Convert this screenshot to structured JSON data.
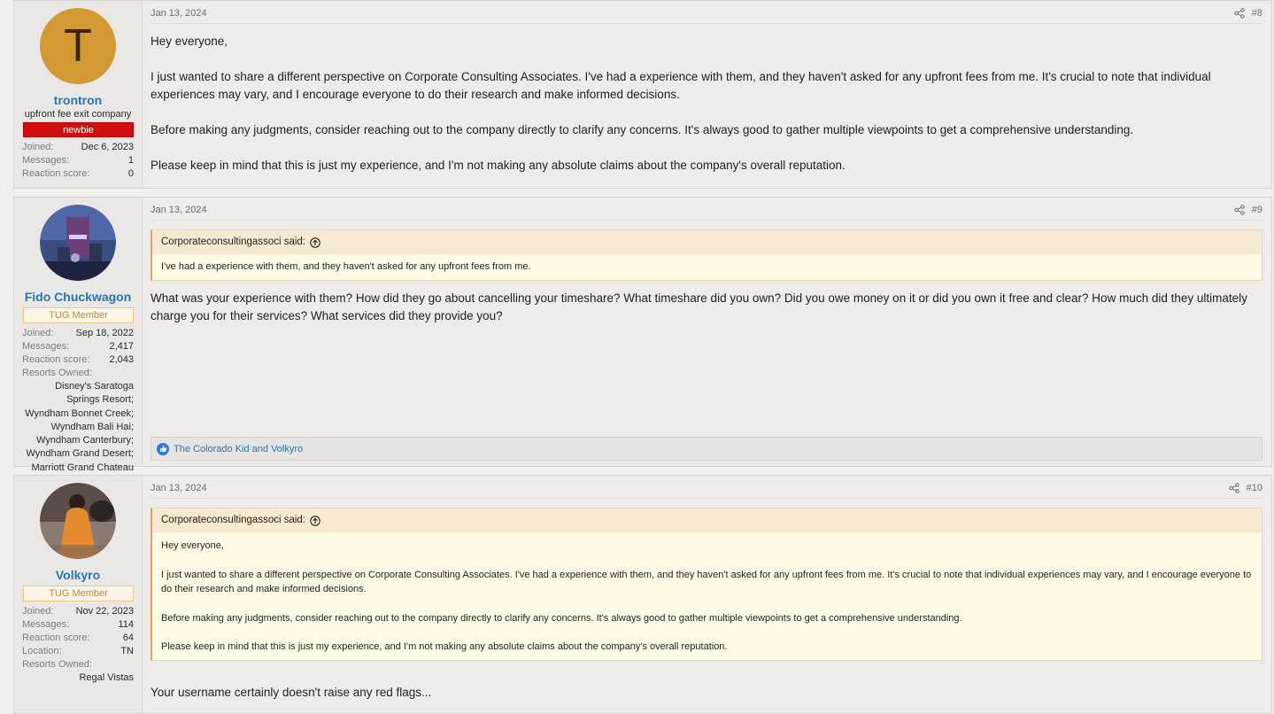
{
  "posts": [
    {
      "date": "Jan 13, 2024",
      "number": "#8",
      "user": {
        "avatar_letter": "T",
        "name": "trontron",
        "title": "upfront fee exit company",
        "banner": "newbie",
        "stats": [
          {
            "label": "Joined:",
            "value": "Dec 6, 2023"
          },
          {
            "label": "Messages:",
            "value": "1"
          },
          {
            "label": "Reaction score:",
            "value": "0"
          }
        ]
      },
      "paragraphs": [
        "Hey everyone,",
        "I just wanted to share a different perspective on Corporate Consulting Associates. I've had a experience with them, and they haven't asked for any upfront fees from me. It's crucial to note that individual experiences may vary, and I encourage everyone to do their research and make informed decisions.",
        "Before making any judgments, consider reaching out to the company directly to clarify any concerns. It's always good to gather multiple viewpoints to get a comprehensive understanding.",
        "Please keep in mind that this is just my experience, and I'm not making any absolute claims about the company's overall reputation."
      ]
    },
    {
      "date": "Jan 13, 2024",
      "number": "#9",
      "user": {
        "name": "Fido Chuckwagon",
        "banner": "TUG Member",
        "stats": [
          {
            "label": "Joined:",
            "value": "Sep 18, 2022"
          },
          {
            "label": "Messages:",
            "value": "2,417"
          },
          {
            "label": "Reaction score:",
            "value": "2,043"
          }
        ],
        "resorts_label": "Resorts Owned:",
        "resorts_value": "Disney's Saratoga Springs Resort; Wyndham Bonnet Creek; Wyndham Bali Hai; Wyndham Canterbury; Wyndham Grand Desert; Marriott Grand Chateau"
      },
      "quote": {
        "author": "Corporateconsultingassoci said:",
        "paragraphs": [
          "I've had a experience with them, and they haven't asked for any upfront fees from me."
        ]
      },
      "paragraphs": [
        "What was your experience with them? How did they go about cancelling your timeshare? What timeshare did you own? Did you owe money on it or did you own it free and clear? How much did they ultimately charge you for their services? What services did they provide you?"
      ],
      "reactions": "The Colorado Kid and Volkyro"
    },
    {
      "date": "Jan 13, 2024",
      "number": "#10",
      "user": {
        "name": "Volkyro",
        "banner": "TUG Member",
        "stats": [
          {
            "label": "Joined:",
            "value": "Nov 22, 2023"
          },
          {
            "label": "Messages:",
            "value": "114"
          },
          {
            "label": "Reaction score:",
            "value": "64"
          },
          {
            "label": "Location:",
            "value": "TN"
          }
        ],
        "resorts_label": "Resorts Owned:",
        "resorts_value": "Regal Vistas"
      },
      "quote": {
        "author": "Corporateconsultingassoci said:",
        "paragraphs": [
          "Hey everyone,",
          "I just wanted to share a different perspective on Corporate Consulting Associates. I've had a experience with them, and they haven't asked for any upfront fees from me. It's crucial to note that individual experiences may vary, and I encourage everyone to do their research and make informed decisions.",
          "Before making any judgments, consider reaching out to the company directly to clarify any concerns. It's always good to gather multiple viewpoints to get a comprehensive understanding.",
          "Please keep in mind that this is just my experience, and I'm not making any absolute claims about the company's overall reputation."
        ]
      },
      "paragraphs": [
        "Your username certainly doesn't raise any red flags..."
      ]
    }
  ],
  "icons": {
    "share": "share-icon",
    "quote_up": "arrow-up-circle-icon",
    "like": "like-icon"
  },
  "colors": {
    "username": "#2577b1",
    "newbie_banner": "#d20d0d",
    "tug_banner_border": "#e9c88a",
    "quote_border": "#e0a45a",
    "quote_bg": "#fdfbe6"
  }
}
